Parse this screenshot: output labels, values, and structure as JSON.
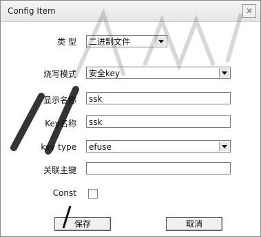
{
  "window": {
    "title": "Config Item",
    "close_symbol": "✕"
  },
  "form": {
    "type_label": "类  型",
    "type_value": "二进制文件",
    "burn_mode_label": "烧写模式",
    "burn_mode_value": "安全key",
    "display_name_label": "显示名称",
    "display_name_value": "ssk",
    "key_name_label": "Key名称",
    "key_name_value": "ssk",
    "key_type_label": "key type",
    "key_type_value": "efuse",
    "primary_key_label": "关联主键",
    "primary_key_value": "",
    "const_label": "Const",
    "const_checked": false
  },
  "buttons": {
    "save": "保存",
    "cancel": "取消"
  },
  "icons": [
    "close-icon",
    "dropdown-arrow-icon"
  ]
}
